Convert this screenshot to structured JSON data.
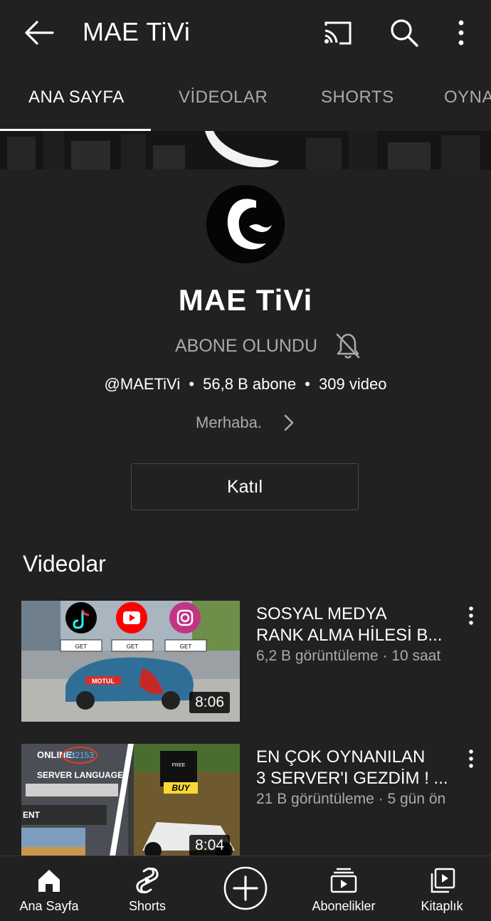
{
  "header": {
    "title": "MAE TiVi",
    "icons": [
      "back-arrow-icon",
      "cast-icon",
      "search-icon",
      "more-vert-icon"
    ]
  },
  "tabs": [
    {
      "label": "ANA SAYFA",
      "active": true
    },
    {
      "label": "VİDEOLAR",
      "active": false
    },
    {
      "label": "SHORTS",
      "active": false
    },
    {
      "label": "OYNA",
      "active": false
    }
  ],
  "channel": {
    "name": "MAE TiVi",
    "subscribe_status": "ABONE OLUNDU",
    "handle": "@MAETiVi",
    "subscribers": "56,8 B abone",
    "video_count": "309 video",
    "separator": "•",
    "about": "Merhaba.",
    "join_label": "Katıl"
  },
  "videos_section": {
    "title": "Videolar",
    "items": [
      {
        "title_line1": "SOSYAL MEDYA",
        "title_line2": "RANK ALMA HİLESİ B...",
        "views": "6,2 B görüntüleme",
        "age": "10 saat",
        "duration": "8:06",
        "thumb_text": [
          "GET",
          "GET",
          "GET",
          "MOTUL"
        ]
      },
      {
        "title_line1": "EN ÇOK OYNANILAN",
        "title_line2": "3 SERVER'I GEZDİM ! ...",
        "views": "21 B görüntüleme",
        "age": "5 gün ön",
        "duration": "8:04",
        "thumb_text": [
          "ONLINE:",
          "532153",
          "SERVER LANGUAGE:",
          "ENT",
          "BUY",
          "FREE"
        ]
      }
    ],
    "meta_separator": "·"
  },
  "bottom_nav": [
    {
      "label": "Ana Sayfa",
      "icon": "home-icon"
    },
    {
      "label": "Shorts",
      "icon": "shorts-icon"
    },
    {
      "label": "",
      "icon": "create-icon"
    },
    {
      "label": "Abonelikler",
      "icon": "subscriptions-icon"
    },
    {
      "label": "Kitaplık",
      "icon": "library-icon"
    }
  ],
  "colors": {
    "background": "#212121",
    "text_primary": "#ffffff",
    "text_secondary": "#aaaaaa",
    "tiktok": "#000000",
    "youtube": "#ff0000",
    "instagram": "#c13584"
  }
}
